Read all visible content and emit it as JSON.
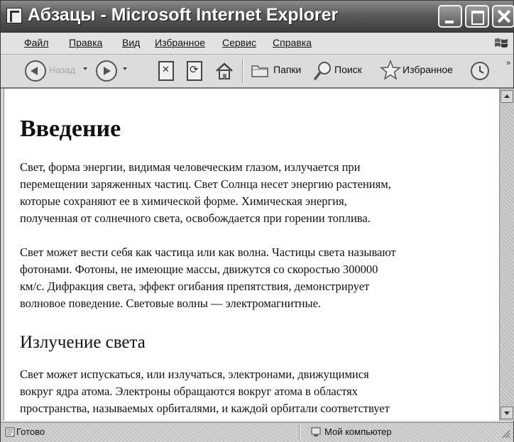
{
  "window": {
    "title": "Абзацы - Microsoft Internet Explorer"
  },
  "menu": {
    "items": [
      "Файл",
      "Правка",
      "Вид",
      "Избранное",
      "Сервис",
      "Справка"
    ]
  },
  "toolbar": {
    "back_label": "Назад",
    "folders_label": "Папки",
    "search_label": "Поиск",
    "favorites_label": "Избранное",
    "more_label": "»",
    "icons": [
      "back-icon",
      "forward-icon",
      "stop-icon",
      "refresh-icon",
      "home-icon",
      "folders-icon",
      "search-icon",
      "favorites-icon",
      "history-icon"
    ]
  },
  "document": {
    "heading1": "Введение",
    "para1": [
      "Свет, форма энергии, видимая человеческим глазом, излучается при",
      "перемещении заряженных частиц. Свет Солнца несет энергию растениям,",
      "которые сохраняют ее в химической форме. Химическая энергия,",
      "полученная от солнечного света, освобождается при горении топлива."
    ],
    "para2": [
      "Свет может вести себя как частица или как волна. Частицы света называют",
      "фотонами. Фотоны, не имеющие массы, движутся со скоростью 300000",
      "км/с. Дифракция света, эффект огибания препятствия, демонстрирует",
      "волновое поведение. Световые волны — электромагнитные."
    ],
    "heading2": "Излучение света",
    "para3": [
      "Свет может испускаться, или излучаться, электронами, движущимися",
      "вокруг ядра атома. Электроны обращаются вокруг атома в областях",
      "пространства, называемых орбиталями, и каждой орбитали соответствует"
    ]
  },
  "status": {
    "text": "Готово",
    "zone": "Мой компьютер"
  }
}
